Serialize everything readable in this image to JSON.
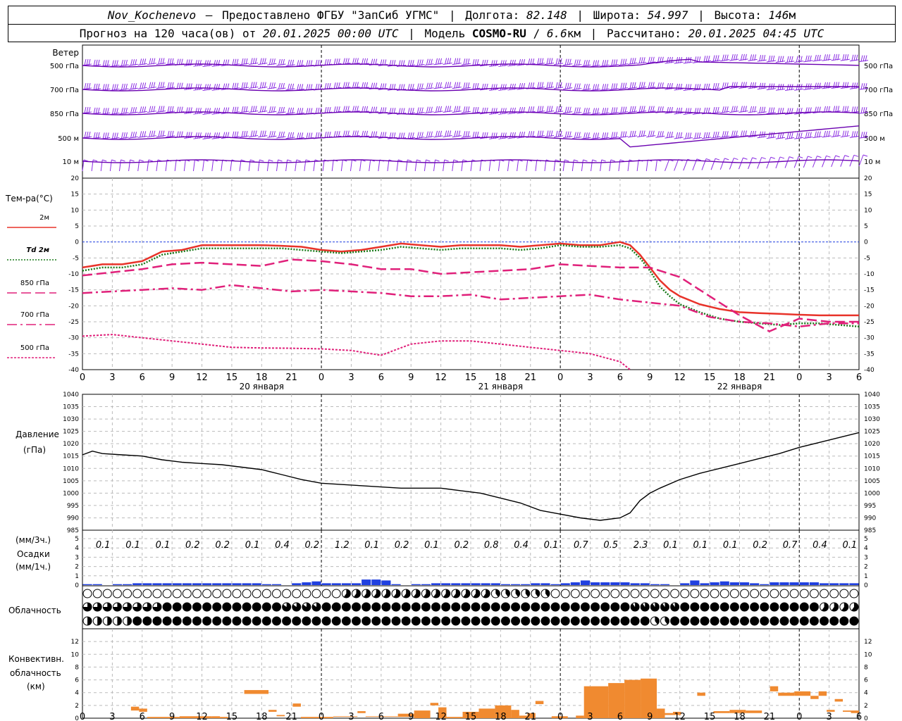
{
  "header": {
    "station": "Nov_Kochenevo",
    "dash": "—",
    "provider": "Предоставлено ФГБУ \"ЗапСиб УГМС\"",
    "lon_label": "Долгота:",
    "lon": "82.148",
    "lat_label": "Широта:",
    "lat": "54.997",
    "alt_label": "Высота:",
    "alt": "146",
    "alt_unit": "м",
    "forecast_label": "Прогноз на 120 часа(ов) от",
    "forecast_from": "20.01.2025 00:00 UTC",
    "model_label": "Модель",
    "model": "COSMO-RU",
    "model_res": "6.6",
    "model_res_unit": "км",
    "calc_label": "Рассчитано:",
    "calc_time": "20.01.2025 04:45 UTC"
  },
  "chart_data": [
    {
      "type": "line",
      "panel": "wind",
      "title": "Ветер",
      "levels": [
        "500 гПа",
        "700 гПа",
        "850 гПа",
        "500 м",
        "10  м"
      ],
      "barb_color": "#8a2be2",
      "level_line_color": "#6a00b0"
    },
    {
      "type": "line",
      "panel": "temperature",
      "ylabel": "Тем-ра(°C)",
      "ylim": [
        -40,
        20
      ],
      "yticks": [
        20,
        15,
        10,
        5,
        0,
        -5,
        -10,
        -15,
        -20,
        -25,
        -30,
        -35,
        -40
      ],
      "x_hours": [
        0,
        3,
        6,
        9,
        12,
        15,
        18,
        21,
        24,
        27,
        30,
        33,
        36,
        39,
        42,
        45,
        48,
        51,
        54,
        57,
        60,
        63,
        66,
        69,
        72,
        75,
        78
      ],
      "x_tick_labels": [
        "0",
        "3",
        "6",
        "9",
        "12",
        "15",
        "18",
        "21",
        "0",
        "3",
        "6",
        "9",
        "12",
        "15",
        "18",
        "21",
        "0",
        "3",
        "6",
        "9",
        "12",
        "15",
        "18",
        "21",
        "0",
        "3",
        "6"
      ],
      "day_labels": [
        {
          "hour": 18,
          "label": "20 января"
        },
        {
          "hour": 42,
          "label": "21 января"
        },
        {
          "hour": 66,
          "label": "22 января"
        }
      ],
      "series": [
        {
          "name": "2м",
          "color": "#e8332a",
          "style": "solid",
          "width": 2.5,
          "x": [
            0,
            2,
            4,
            6,
            8,
            10,
            12,
            14,
            16,
            18,
            20,
            22,
            24,
            26,
            28,
            30,
            32,
            34,
            36,
            38,
            40,
            42,
            44,
            46,
            48,
            50,
            52,
            54,
            55,
            56,
            57,
            58,
            59,
            60,
            62,
            64,
            66,
            68,
            70,
            72,
            74,
            76,
            78
          ],
          "y": [
            -8,
            -7,
            -7,
            -6,
            -3,
            -2.5,
            -1,
            -1,
            -1,
            -1,
            -1.2,
            -1.5,
            -2.5,
            -3,
            -2.5,
            -1.5,
            -0.5,
            -1,
            -1.5,
            -1,
            -1,
            -1,
            -1.5,
            -1,
            -0.5,
            -1,
            -1,
            0,
            -1,
            -4,
            -8,
            -12,
            -15,
            -17,
            -19.5,
            -21,
            -22,
            -22.3,
            -22.5,
            -22.8,
            -23,
            -23,
            -23
          ]
        },
        {
          "name": "Td  2м",
          "color": "#1a7a1a",
          "style": "dotted",
          "width": 2.5,
          "x": [
            0,
            2,
            4,
            6,
            8,
            10,
            12,
            14,
            16,
            18,
            20,
            22,
            24,
            26,
            28,
            30,
            32,
            34,
            36,
            38,
            40,
            42,
            44,
            46,
            48,
            50,
            52,
            54,
            55,
            56,
            57,
            58,
            59,
            60,
            62,
            64,
            66,
            68,
            70,
            72,
            74,
            76,
            78
          ],
          "y": [
            -9,
            -8,
            -8,
            -7,
            -4,
            -3,
            -2,
            -2,
            -2,
            -2,
            -2,
            -2.5,
            -3,
            -3.5,
            -3,
            -2.5,
            -1.5,
            -2,
            -2.5,
            -2,
            -2,
            -2,
            -2.5,
            -2,
            -1,
            -1.5,
            -1.5,
            -1,
            -2,
            -5,
            -9,
            -14,
            -17,
            -19.5,
            -22,
            -24,
            -25,
            -25.5,
            -26,
            -25.5,
            -25.5,
            -26,
            -26.5
          ]
        },
        {
          "name": "850 гПа",
          "color": "#e0207a",
          "style": "dash",
          "width": 2.5,
          "x": [
            0,
            3,
            6,
            9,
            12,
            15,
            18,
            21,
            24,
            27,
            30,
            33,
            36,
            39,
            42,
            45,
            48,
            51,
            54,
            57,
            60,
            63,
            66,
            69,
            72,
            75,
            78
          ],
          "y": [
            -10.5,
            -9.5,
            -8.5,
            -7,
            -6.5,
            -7,
            -7.5,
            -5.5,
            -6,
            -7,
            -8.5,
            -8.5,
            -10,
            -9.5,
            -9,
            -8.5,
            -7,
            -7.5,
            -8,
            -8,
            -11,
            -17,
            -23,
            -28,
            -24,
            -25,
            -25
          ]
        },
        {
          "name": "700 гПа",
          "color": "#e0207a",
          "style": "dashdot",
          "width": 2.5,
          "x": [
            0,
            3,
            6,
            9,
            12,
            15,
            18,
            21,
            24,
            27,
            30,
            33,
            36,
            39,
            42,
            45,
            48,
            51,
            54,
            57,
            60,
            63,
            66,
            69,
            72,
            75,
            78
          ],
          "y": [
            -16,
            -15.5,
            -15,
            -14.5,
            -15,
            -13.5,
            -14.5,
            -15.5,
            -15,
            -15.5,
            -16,
            -17,
            -17,
            -16.5,
            -18,
            -17.5,
            -17,
            -16.5,
            -18,
            -19,
            -20,
            -23.5,
            -25,
            -25.5,
            -26.5,
            -25.5,
            -25.5
          ]
        },
        {
          "name": "500 гПа",
          "color": "#e0207a",
          "style": "dotted-fine",
          "width": 2,
          "x": [
            0,
            3,
            6,
            9,
            12,
            15,
            18,
            21,
            24,
            27,
            30,
            33,
            36,
            39,
            42,
            45,
            48,
            51,
            54,
            55
          ],
          "y": [
            -29.5,
            -29,
            -30,
            -31,
            -32,
            -33,
            -33.2,
            -33.3,
            -33.5,
            -34,
            -35.5,
            -32,
            -31,
            -31,
            -32,
            -33,
            -34,
            -35,
            -37.5,
            -40
          ]
        }
      ]
    },
    {
      "type": "line",
      "panel": "pressure",
      "ylabel": "Давление",
      "yunit": "(гПа)",
      "ylim": [
        985,
        1040
      ],
      "yticks": [
        1040,
        1035,
        1030,
        1025,
        1020,
        1015,
        1010,
        1005,
        1000,
        995,
        990,
        985
      ],
      "series": [
        {
          "name": "Давление",
          "color": "#000000",
          "x": [
            0,
            1,
            2,
            4,
            6,
            8,
            10,
            12,
            14,
            16,
            18,
            20,
            22,
            24,
            26,
            28,
            30,
            32,
            34,
            36,
            38,
            40,
            42,
            44,
            46,
            48,
            50,
            52,
            54,
            55,
            56,
            57,
            58,
            60,
            62,
            64,
            66,
            68,
            70,
            72,
            74,
            76,
            78
          ],
          "y": [
            1015.5,
            1017,
            1016,
            1015.5,
            1015,
            1013.5,
            1012.5,
            1012,
            1011.5,
            1010.5,
            1009.5,
            1007.5,
            1005.5,
            1004,
            1003.5,
            1003,
            1002.5,
            1002,
            1002,
            1002,
            1001,
            1000,
            998,
            996,
            993,
            991.5,
            990,
            989,
            990,
            992,
            997,
            1000,
            1002,
            1005.5,
            1008,
            1010,
            1012,
            1014,
            1016,
            1018.5,
            1020.5,
            1022.5,
            1024.5
          ]
        }
      ]
    },
    {
      "type": "bar",
      "panel": "precipitation",
      "ylabel_top": "(мм/3ч.)",
      "ylabel": "Осадки",
      "ylabel_bottom": "(мм/1ч.)",
      "ylim": [
        0,
        5
      ],
      "yticks": [
        5,
        4,
        3,
        2,
        1,
        0
      ],
      "totals_3h": [
        "0.1",
        "0.1",
        "0.1",
        "0.2",
        "0.2",
        "0.1",
        "0.4",
        "0.2",
        "1.2",
        "0.1",
        "0.2",
        "0.1",
        "0.2",
        "0.8",
        "0.4",
        "0.1",
        "0.7",
        "0.5",
        "2.3",
        "0.1",
        "0.1",
        "0.1",
        "0.2",
        "0.7",
        "0.4",
        "0.1"
      ],
      "hourly_rain_color": "#2040e0",
      "hourly_snow_color": "#20c020",
      "hourly_blue": [
        0.1,
        0.1,
        0,
        0.1,
        0.1,
        0.2,
        0.2,
        0.2,
        0.2,
        0.2,
        0.2,
        0.2,
        0.2,
        0.2,
        0.2,
        0.2,
        0.2,
        0.2,
        0.1,
        0.1,
        0,
        0.2,
        0.3,
        0.4,
        0.2,
        0.2,
        0.2,
        0.2,
        0.6,
        0.6,
        0.5,
        0.1,
        0,
        0.1,
        0.1,
        0.2,
        0.2,
        0.2,
        0.2,
        0.2,
        0.2,
        0.2,
        0.1,
        0.1,
        0.1,
        0.2,
        0.2,
        0.1,
        0.2,
        0.3,
        0.5,
        0.3,
        0.3,
        0.3,
        0.3,
        0.2,
        0.2,
        0.1,
        0.1,
        0,
        0.2,
        0.5,
        0.2,
        0.3,
        0.4,
        0.3,
        0.3,
        0.2,
        0.1,
        0.3,
        0.3,
        0.3,
        0.3,
        0.3,
        0.2,
        0.2,
        0.2,
        0.2,
        0.2,
        0.2
      ],
      "hourly_green": [
        0,
        0,
        0,
        0,
        0,
        0,
        0,
        0,
        0,
        0,
        0,
        0,
        0,
        0,
        0,
        0,
        0,
        0,
        0,
        0,
        0,
        0,
        0,
        0,
        0,
        0,
        0,
        0,
        0,
        0,
        0,
        0,
        0,
        0,
        0,
        0,
        0,
        0,
        0,
        0,
        0,
        0,
        0,
        0,
        0,
        0,
        0,
        0,
        0,
        0,
        0,
        0,
        0,
        0,
        0,
        0,
        0,
        0,
        0,
        0,
        0,
        0,
        0,
        0,
        0,
        0,
        0,
        0,
        0,
        0,
        0,
        0,
        0,
        0,
        0,
        0,
        0,
        0,
        0,
        0
      ]
    },
    {
      "type": "table",
      "panel": "cloudiness",
      "ylabel": "Облачность",
      "rows": [
        "high",
        "middle",
        "low"
      ]
    },
    {
      "type": "bar",
      "panel": "convective",
      "ylabel": "Конвективн.",
      "ylabel2": "облачность",
      "yunit": "(км)",
      "ylim": [
        0,
        14
      ],
      "yticks": [
        12,
        10,
        8,
        6,
        4,
        2,
        0
      ],
      "color": "#f08a30"
    }
  ]
}
